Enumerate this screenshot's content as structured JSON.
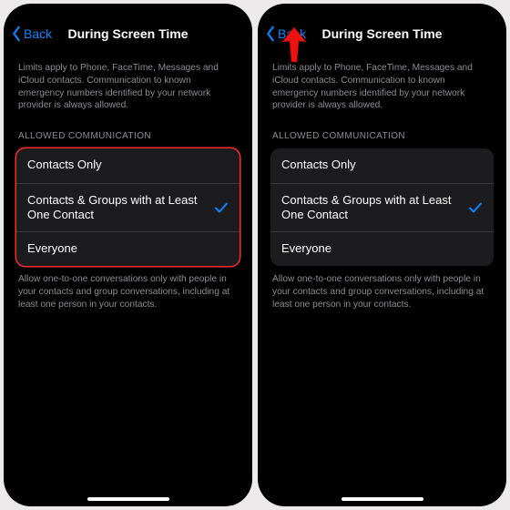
{
  "nav": {
    "back": "Back",
    "title": "During Screen Time"
  },
  "intro": "Limits apply to Phone, FaceTime, Messages and iCloud contacts. Communication to known emergency numbers identified by your network provider is always allowed.",
  "section_header": "ALLOWED COMMUNICATION",
  "options": [
    {
      "label": "Contacts Only",
      "selected": false
    },
    {
      "label": "Contacts & Groups with at Least One Contact",
      "selected": true
    },
    {
      "label": "Everyone",
      "selected": false
    }
  ],
  "footer": "Allow one-to-one conversations only with people in your contacts and group conversations, including at least one person in your contacts.",
  "left_highlight": true,
  "right_arrow": true
}
